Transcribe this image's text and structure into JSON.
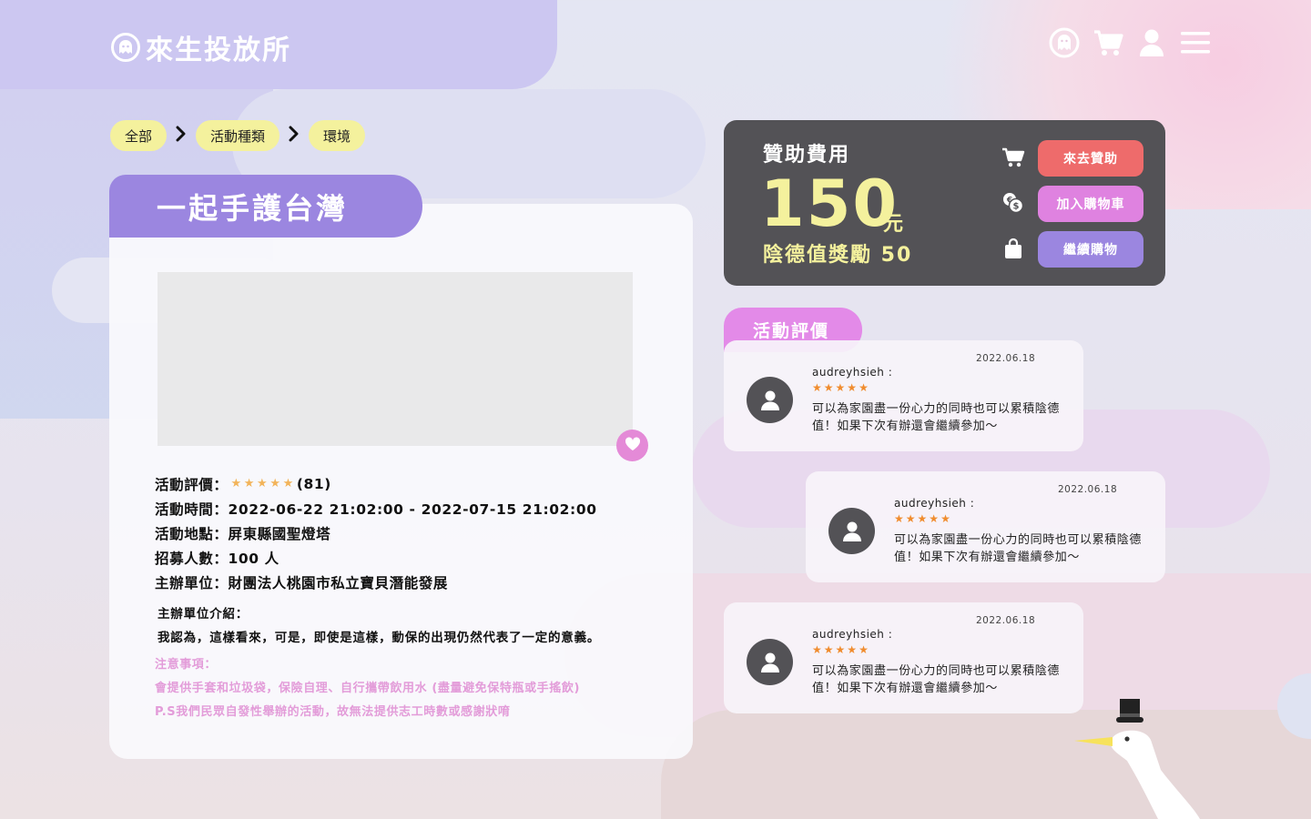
{
  "brand": {
    "name": "來生投放所"
  },
  "breadcrumb": {
    "items": [
      "全部",
      "活動種類",
      "環境"
    ]
  },
  "activity": {
    "title": "一起手護台灣",
    "rating_label": "活動評價：",
    "rating_stars": 5,
    "rating_count": "(81)",
    "time": "活動時間：2022-06-22 21:02:00 - 2022-07-15 21:02:00",
    "location": "活動地點：屏東縣國聖燈塔",
    "recruit": "招募人數：100 人",
    "organizer": "主辦單位：財團法人桃園市私立寶貝潛能發展",
    "org_intro_label": "主辦單位介紹：",
    "org_intro": "我認為，這樣看來，可是，即使是這樣，動保的出現仍然代表了一定的意義。",
    "notes_label": "注意事項：",
    "notes_line1": "會提供手套和垃圾袋，保險自理、自行攜帶飲用水 (盡量避免保特瓶或手搖飲)",
    "notes_line2": " P.S我們民眾自發性舉辦的活動，故無法提供志工時數或感謝狀唷"
  },
  "sponsor": {
    "label": "贊助費用",
    "price": "150",
    "unit": "元",
    "reward": "陰德值獎勵 50",
    "btn_sponsor": "來去贊助",
    "btn_add_cart": "加入購物車",
    "btn_continue": "繼續購物"
  },
  "reviews": {
    "title": "活動評價",
    "items": [
      {
        "name": "audreyhsieh :",
        "date": "2022.06.18",
        "stars": 5,
        "text": "可以為家園盡一份心力的同時也可以累積陰德值！如果下次有辦還會繼續參加～"
      },
      {
        "name": "audreyhsieh :",
        "date": "2022.06.18",
        "stars": 5,
        "text": "可以為家園盡一份心力的同時也可以累積陰德值！如果下次有辦還會繼續參加～"
      },
      {
        "name": "audreyhsieh :",
        "date": "2022.06.18",
        "stars": 5,
        "text": "可以為家園盡一份心力的同時也可以累積陰德值！如果下次有辦還會繼續參加～"
      }
    ]
  },
  "icons": {
    "nav": [
      "ghost-icon",
      "cart-icon",
      "user-icon",
      "menu-icon"
    ],
    "sponsor": [
      "cart-icon",
      "coins-icon",
      "bag-icon"
    ]
  },
  "colors": {
    "purple": "#9b86e0",
    "pink": "#e38ae8",
    "red": "#ee6b6b",
    "yellow": "#f4f19d",
    "dark": "#535256"
  }
}
